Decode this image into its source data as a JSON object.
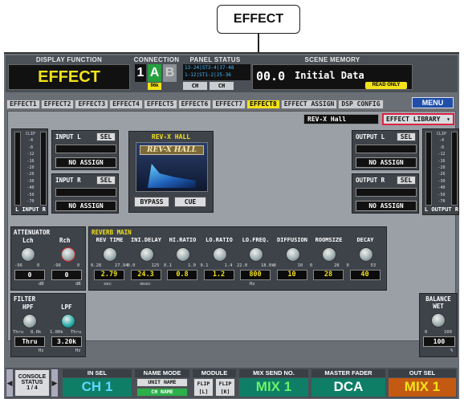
{
  "callout": "EFFECT",
  "header": {
    "display_function_label": "DISPLAY FUNCTION",
    "display_function": "EFFECT",
    "connection_label": "CONNECTION",
    "conn_1": "1",
    "conn_a": "A",
    "conn_b": "B",
    "conn_fs": "96k",
    "panel_status_label": "PANEL STATUS",
    "panel_status_line1": "13-24",
    "panel_status_line2": "1-12",
    "panel_status_st1": "ST3-4",
    "panel_status_st2": "ST1-2",
    "panel_status_n1": "37-48",
    "panel_status_n2": "25-36",
    "panel_ch": "CH",
    "panel_ch2": "CH",
    "scene_memory_label": "SCENE MEMORY",
    "scene_number": "00.0",
    "scene_name": "Initial Data",
    "read_only": "READ ONLY"
  },
  "tabs": [
    "EFFECT1",
    "EFFECT2",
    "EFFECT3",
    "EFFECT4",
    "EFFECT5",
    "EFFECT6",
    "EFFECT7",
    "EFFECT8",
    "EFFECT ASSIGN",
    "DSP CONFIG"
  ],
  "menu": "MENU",
  "effect_type": "REV-X Hall",
  "effect_library": "EFFECT LIBRARY",
  "input_l": {
    "label": "INPUT L",
    "sel": "SEL",
    "assign": "NO ASSIGN"
  },
  "input_r": {
    "label": "INPUT R",
    "sel": "SEL",
    "assign": "NO ASSIGN"
  },
  "output_l": {
    "label": "OUTPUT L",
    "sel": "SEL",
    "assign": "NO ASSIGN"
  },
  "output_r": {
    "label": "OUTPUT R",
    "sel": "SEL",
    "assign": "NO ASSIGN"
  },
  "meter_in_label": "L  INPUT  R",
  "meter_out_label": "L  OUTPUT  R",
  "meter_scale": [
    "CLIP",
    "-4",
    "-8",
    "-12",
    "-16",
    "-20",
    "-26",
    "-30",
    "-40",
    "-50",
    "-70"
  ],
  "rev": {
    "title": "REV-X HALL",
    "logo": "REV-X HALL",
    "bypass": "BYPASS",
    "cue": "CUE"
  },
  "attenuator": {
    "title": "ATTENUATOR",
    "lch": "Lch",
    "rch": "Rch",
    "lch_min": "-96",
    "lch_max": "0",
    "rch_min": "-96",
    "rch_max": "0",
    "lch_val": "0",
    "rch_val": "0",
    "unit": "dB",
    "unit2": "dB"
  },
  "reverb": {
    "title": "REVERB MAIN",
    "params": [
      {
        "name": "REV TIME",
        "min": "0.28",
        "max": "27.94",
        "value": "2.79",
        "unit": "sec"
      },
      {
        "name": "INI.DELAY",
        "min": "0.0",
        "max": "125",
        "value": "24.3",
        "unit": "msec"
      },
      {
        "name": "HI.RATIO",
        "min": "0.1",
        "max": "1.0",
        "value": "0.8",
        "unit": ""
      },
      {
        "name": "LO.RATIO",
        "min": "0.1",
        "max": "1.4",
        "value": "1.2",
        "unit": ""
      },
      {
        "name": "LO.FREQ.",
        "min": "22.0",
        "max": "18.0k",
        "value": "800",
        "unit": "Hz"
      },
      {
        "name": "DIFFUSION",
        "min": "0",
        "max": "10",
        "value": "10",
        "unit": ""
      },
      {
        "name": "ROOMSIZE",
        "min": "0",
        "max": "28",
        "value": "28",
        "unit": ""
      },
      {
        "name": "DECAY",
        "min": "0",
        "max": "53",
        "value": "40",
        "unit": ""
      }
    ]
  },
  "filter": {
    "title": "FILTER",
    "hpf": "HPF",
    "lpf": "LPF",
    "hpf_min": "Thru",
    "hpf_max": "8.0k",
    "lpf_min": "1.00k",
    "lpf_max": "Thru",
    "hpf_val": "Thru",
    "lpf_val": "3.20k",
    "unit": "Hz",
    "unit2": "Hz"
  },
  "balance": {
    "title": "BALANCE",
    "sub": "WET",
    "min": "0",
    "max": "100",
    "value": "100",
    "unit": "%"
  },
  "bottom": {
    "console_status": "CONSOLE STATUS",
    "page": "1 / 4",
    "in_sel_label": "IN SEL",
    "in_sel": "CH 1",
    "name_mode_label": "NAME MODE",
    "unit_name": "UNIT NAME",
    "ch_name": "CH NAME",
    "module_label": "MODULE",
    "flip_l": "FLIP [L]",
    "flip_r": "FLIP [R]",
    "mix_send_label": "MIX SEND NO.",
    "mix_send": "MIX 1",
    "master_fader_label": "MASTER FADER",
    "master_fader": "DCA",
    "out_sel_label": "OUT SEL",
    "out_sel": "MIX 1"
  }
}
